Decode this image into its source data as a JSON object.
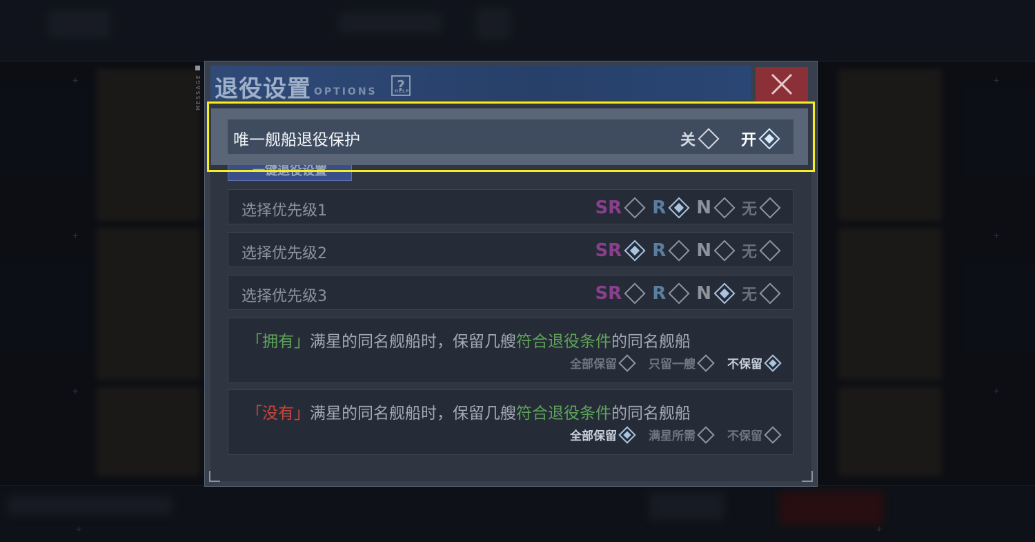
{
  "dialog": {
    "title": "退役设置",
    "subtitle": "OPTIONS",
    "help_label": "?",
    "help_small": "HELP",
    "message_tab": "MESSAGE",
    "close_icon": "close-icon"
  },
  "protection": {
    "label": "唯一舰船退役保护",
    "off_label": "关",
    "on_label": "开",
    "selected": "开"
  },
  "section_tab": "一键退役设置",
  "priorities": [
    {
      "label": "选择优先级1",
      "options": [
        "SR",
        "R",
        "N",
        "无"
      ],
      "selected": "R"
    },
    {
      "label": "选择优先级2",
      "options": [
        "SR",
        "R",
        "N",
        "无"
      ],
      "selected": "SR"
    },
    {
      "label": "选择优先级3",
      "options": [
        "SR",
        "R",
        "N",
        "无"
      ],
      "selected": "N"
    }
  ],
  "owned_rule": {
    "tag": "「拥有」",
    "text_a": "满星的同名舰船时，保留几艘",
    "highlight": "符合退役条件",
    "text_b": "的同名舰船",
    "options": [
      "全部保留",
      "只留一艘",
      "不保留"
    ],
    "selected": "不保留"
  },
  "missing_rule": {
    "tag": "「没有」",
    "text_a": "满星的同名舰船时，保留几艘",
    "highlight": "符合退役条件",
    "text_b": "的同名舰船",
    "options": [
      "全部保留",
      "满星所需",
      "不保留"
    ],
    "selected": "全部保留"
  },
  "colors": {
    "sr": "#8a3f8c",
    "r": "#5a7ea0",
    "n": "#8d939b",
    "none": "#6a717c",
    "green": "#5ea35a",
    "red": "#c8463c",
    "highlight_border": "#f5ee20",
    "close_bg": "#8c3038"
  }
}
